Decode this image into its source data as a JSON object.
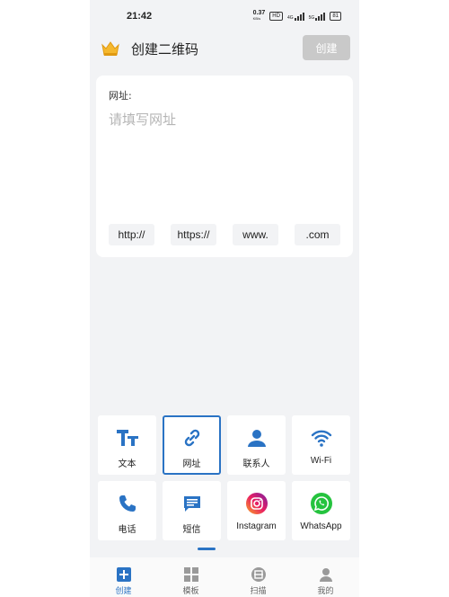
{
  "status_bar": {
    "time": "21:42",
    "speed": "0.37",
    "speed_unit": "KB/s",
    "hd": "HD",
    "net_1": "4G",
    "net_2": "5G",
    "battery": "81"
  },
  "header": {
    "title": "创建二维码",
    "create_button": "创建",
    "crown_icon": "crown-icon"
  },
  "url_card": {
    "label": "网址:",
    "placeholder": "请填写网址",
    "quick_inserts": [
      "http://",
      "https://",
      "www.",
      ".com"
    ]
  },
  "types": [
    {
      "label": "文本",
      "icon": "text-icon",
      "selected": false
    },
    {
      "label": "网址",
      "icon": "link-icon",
      "selected": true
    },
    {
      "label": "联系人",
      "icon": "person-icon",
      "selected": false
    },
    {
      "label": "Wi-Fi",
      "icon": "wifi-icon",
      "selected": false
    },
    {
      "label": "电话",
      "icon": "phone-icon",
      "selected": false
    },
    {
      "label": "短信",
      "icon": "message-icon",
      "selected": false
    },
    {
      "label": "Instagram",
      "icon": "instagram-icon",
      "selected": false
    },
    {
      "label": "WhatsApp",
      "icon": "whatsapp-icon",
      "selected": false
    }
  ],
  "bottom_nav": [
    {
      "label": "创建",
      "icon": "plus-icon",
      "active": true
    },
    {
      "label": "模板",
      "icon": "grid-icon",
      "active": false
    },
    {
      "label": "扫描",
      "icon": "scan-icon",
      "active": false
    },
    {
      "label": "我的",
      "icon": "profile-icon",
      "active": false
    }
  ],
  "colors": {
    "accent": "#2a73c4",
    "background": "#f2f3f5",
    "instagram": "#d6336c",
    "whatsapp": "#25c33e"
  }
}
